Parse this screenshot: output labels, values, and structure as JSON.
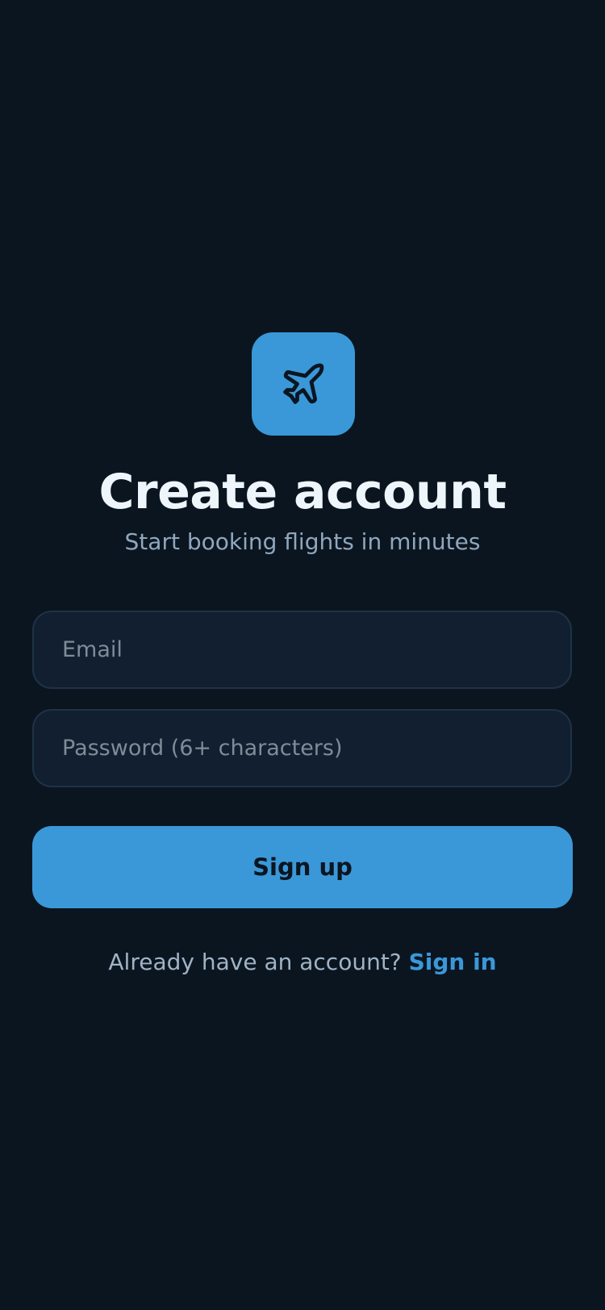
{
  "brand": {
    "icon": "airplane-icon",
    "accent_color": "#3a98d8",
    "background_color": "#0b1520"
  },
  "header": {
    "title": "Create account",
    "subtitle": "Start booking flights in minutes"
  },
  "form": {
    "email": {
      "placeholder": "Email",
      "value": ""
    },
    "password": {
      "placeholder": "Password (6+ characters)",
      "value": ""
    },
    "submit_label": "Sign up"
  },
  "footer": {
    "prompt": "Already have an account?",
    "link_label": "Sign in"
  }
}
